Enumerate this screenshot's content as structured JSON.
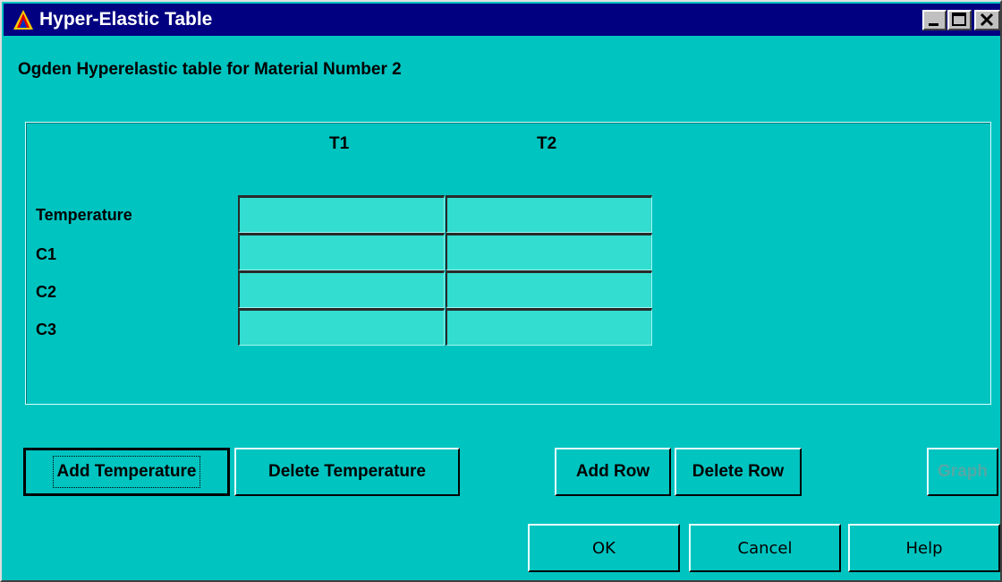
{
  "window": {
    "title": "Hyper-Elastic Table",
    "controls": {
      "minimize": "minimize",
      "maximize": "maximize",
      "close": "close"
    }
  },
  "heading": "Ogden Hyperelastic table for Material Number 2",
  "table": {
    "columns": [
      "T1",
      "T2"
    ],
    "rows": [
      {
        "label": "Temperature",
        "values": [
          "",
          ""
        ]
      },
      {
        "label": "C1",
        "values": [
          "",
          ""
        ]
      },
      {
        "label": "C2",
        "values": [
          "",
          ""
        ]
      },
      {
        "label": "C3",
        "values": [
          "",
          ""
        ]
      }
    ]
  },
  "buttons": {
    "add_temperature": "Add Temperature",
    "delete_temperature": "Delete Temperature",
    "add_row": "Add Row",
    "delete_row": "Delete Row",
    "graph": "Graph",
    "ok": "OK",
    "cancel": "Cancel",
    "help": "Help"
  },
  "colors": {
    "background": "#00c4c0",
    "titlebar": "#000080",
    "cell": "#33ddcf"
  }
}
